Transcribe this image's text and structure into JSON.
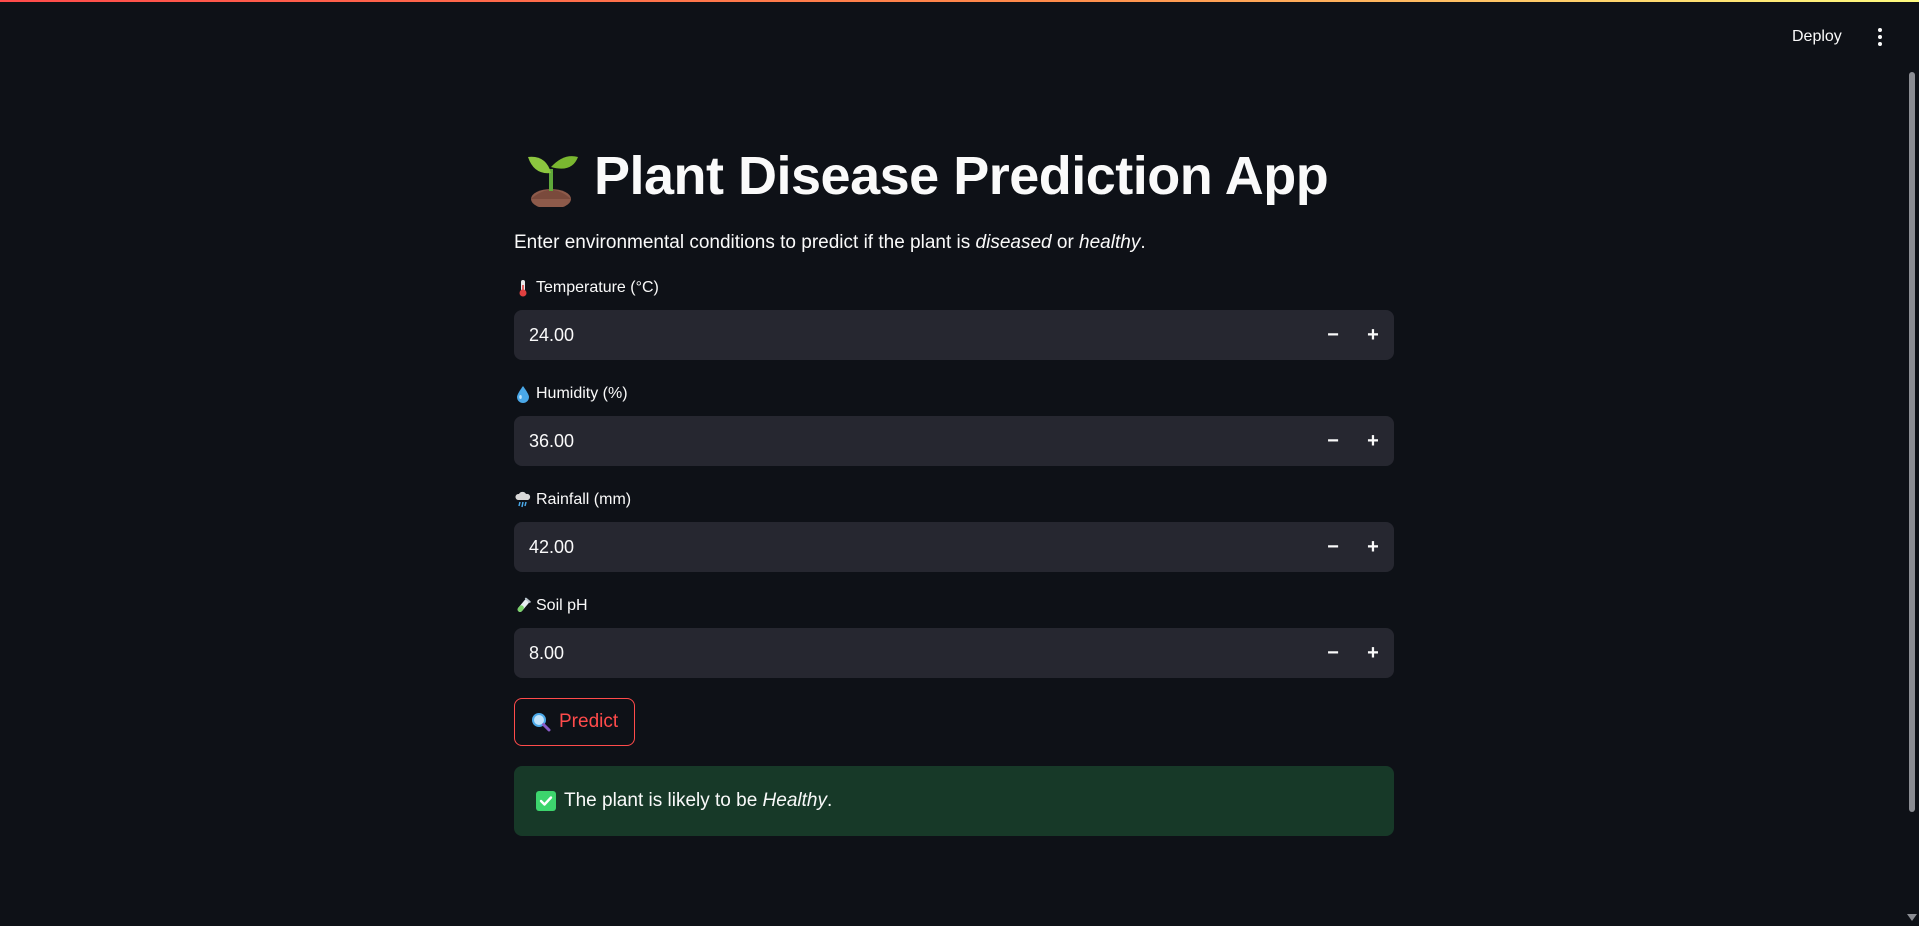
{
  "header": {
    "deploy_label": "Deploy",
    "menu_icon": "vertical-dots-icon"
  },
  "colors": {
    "background": "#0e1117",
    "input_bg": "#262730",
    "accent": "#ff4b4b",
    "success_bg": "#173928",
    "success_check": "#3dd56d"
  },
  "main": {
    "title": "Plant Disease Prediction App",
    "title_icon": "sprout-icon",
    "subtitle_prefix": "Enter environmental conditions to predict if the plant is ",
    "subtitle_diseased": "diseased",
    "subtitle_or": " or ",
    "subtitle_healthy": "healthy",
    "subtitle_end": ".",
    "fields": [
      {
        "label": "Temperature (°C)",
        "icon": "thermometer-icon",
        "value": "24.00"
      },
      {
        "label": "Humidity (%)",
        "icon": "droplet-icon",
        "value": "36.00"
      },
      {
        "label": "Rainfall (mm)",
        "icon": "rain-cloud-icon",
        "value": "42.00"
      },
      {
        "label": "Soil pH",
        "icon": "test-tube-icon",
        "value": "8.00"
      }
    ],
    "stepper_minus": "−",
    "stepper_plus": "+",
    "predict_label": "Predict",
    "predict_icon": "magnifier-icon",
    "result_prefix": "The plant is likely to be ",
    "result_value": "Healthy",
    "result_end": ".",
    "result_icon": "check-box-icon"
  }
}
